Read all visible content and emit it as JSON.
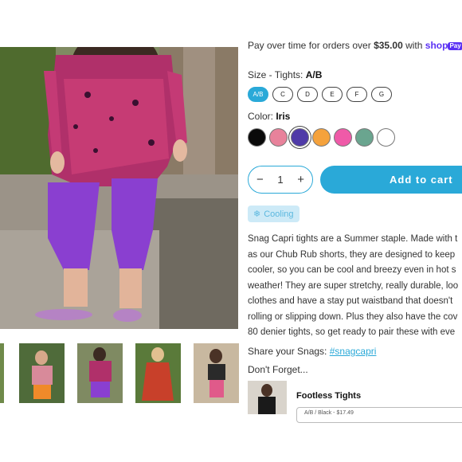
{
  "media": {
    "main_photo_icon": "model-wearing-purple-capri-tights",
    "thumbnails": [
      {
        "name": "thumb-partial"
      },
      {
        "name": "thumb-orange-tights"
      },
      {
        "name": "thumb-pink-dress"
      },
      {
        "name": "thumb-purple-tights"
      },
      {
        "name": "thumb-orange-dress"
      },
      {
        "name": "thumb-seated-pink"
      }
    ],
    "active_thumbnail": 3
  },
  "payment": {
    "text": "Pay over time for orders over ",
    "amount": "$35.00",
    "with": " with ",
    "shop_logo": "shop",
    "shop_pay": "Pay"
  },
  "size": {
    "label": "Size - Tights: ",
    "selected": "A/B",
    "options": [
      "A/B",
      "C",
      "D",
      "E",
      "F",
      "G"
    ]
  },
  "color": {
    "label": "Color: ",
    "selected": "Iris",
    "swatches": [
      "#0a0a0a",
      "#e8829b",
      "#4f3aa8",
      "#f5a23c",
      "#ef5aa8",
      "#6aa58f",
      "#ffffff"
    ],
    "selected_index": 2
  },
  "quantity": {
    "minus": "−",
    "value": "1",
    "plus": "+"
  },
  "add_to_cart": "Add to cart",
  "badge": {
    "icon": "snowflake-icon",
    "label": "Cooling"
  },
  "description": [
    "Snag Capri tights are a Summer staple. Made with t",
    "as our Chub Rub shorts, they are designed to keep",
    "cooler, so you can be cool and breezy even in hot s",
    "weather! They are super stretchy, really durable, loo",
    "clothes and have a stay put waistband that doesn't",
    "rolling or slipping down. Plus they also have the cov",
    "80 denier tights, so get ready to pair these with eve"
  ],
  "share": {
    "label": "Share your Snags: ",
    "hashtag": "#snagcapri"
  },
  "dont_forget": "Don't Forget...",
  "upsell": {
    "title": "Footless Tights",
    "select_value": "A/B / Black - $17.49"
  }
}
